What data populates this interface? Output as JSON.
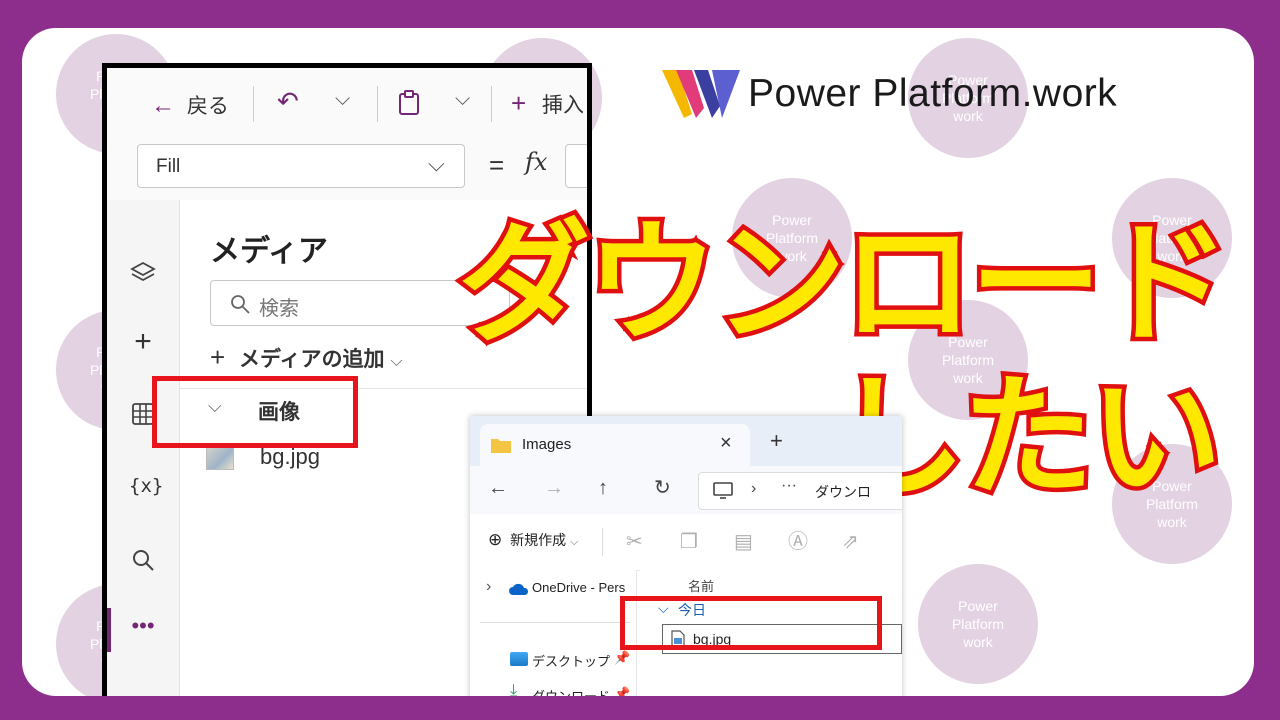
{
  "logo": {
    "text": "Power Platform.work"
  },
  "watermark": {
    "lines": [
      "Power",
      "Platform",
      "work"
    ]
  },
  "headline": {
    "line1": "ダウンロード",
    "line2": "したい"
  },
  "powerapps": {
    "toolbar": {
      "back_label": "戻る",
      "insert_label": "挿入"
    },
    "formula": {
      "property_value": "Fill",
      "equals": "=",
      "fx": "fx"
    },
    "media": {
      "title": "メディア",
      "search_placeholder": "検索",
      "add_media_label": "メディアの追加",
      "group_label": "画像",
      "file_name": "bg.jpg"
    },
    "rail_icons": [
      "layers-icon",
      "plus-icon",
      "table-icon",
      "variables-icon",
      "search-icon",
      "more-icon"
    ]
  },
  "explorer": {
    "tab_title": "Images",
    "new_tab": "+",
    "breadcrumb_folder": "ダウンロ",
    "new_button_label": "新規作成",
    "column_name": "名前",
    "group_today": "今日",
    "file_name": "bg.jpg",
    "sidebar": {
      "onedrive": "OneDrive - Pers",
      "desktop": "デスクトップ",
      "downloads": "ダウンロード"
    }
  },
  "colors": {
    "frame": "#8e2e8c",
    "accent_purple": "#742774",
    "highlight_red": "#e8141b",
    "headline_fill": "#ffe800"
  }
}
